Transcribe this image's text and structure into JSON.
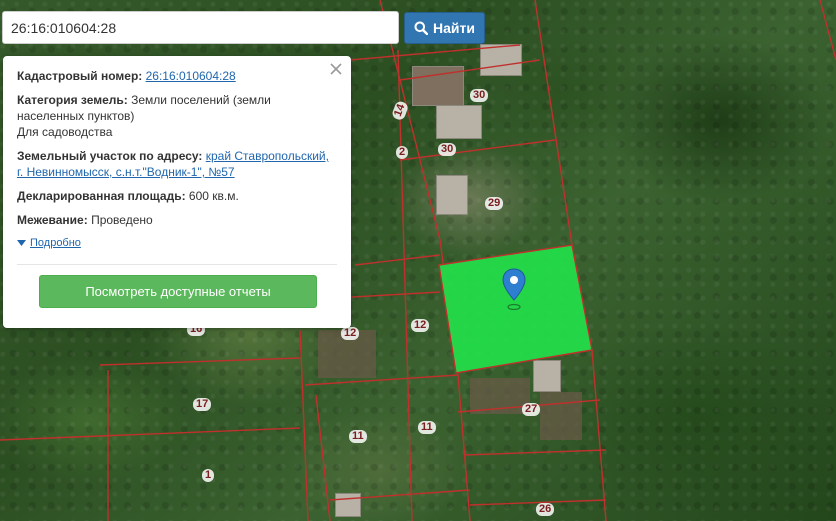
{
  "search": {
    "value": "26:16:010604:28",
    "button_label": "Найти"
  },
  "panel": {
    "cadastral_label": "Кадастровый номер:",
    "cadastral_value": "26:16:010604:28",
    "category_label": "Категория земель:",
    "category_value": "Земли поселений (земли населенных пунктов)",
    "usage": "Для садоводства",
    "address_label": "Земельный участок по адресу:",
    "address_value": "край Ставропольский, г. Невинномысск, с.н.т.\"Водник-1\", №57",
    "area_label": "Декларированная площадь:",
    "area_value": "600 кв.м.",
    "survey_label": "Межевание:",
    "survey_value": "Проведено",
    "more_label": "Подробно",
    "reports_button": "Посмотреть доступные отчеты"
  },
  "parcel_labels": [
    "30",
    "14",
    "30",
    "2",
    "29",
    "12",
    "12",
    "16",
    "17",
    "27",
    "11",
    "11",
    "1",
    "26"
  ],
  "colors": {
    "highlight": "#22e04a",
    "boundary": "#c0302c",
    "search_button": "#3276b1",
    "reports_button": "#5cb85c"
  },
  "icons": {
    "search": "search-icon",
    "close": "close-icon",
    "pin": "map-pin-icon",
    "triangle": "triangle-down-icon"
  }
}
